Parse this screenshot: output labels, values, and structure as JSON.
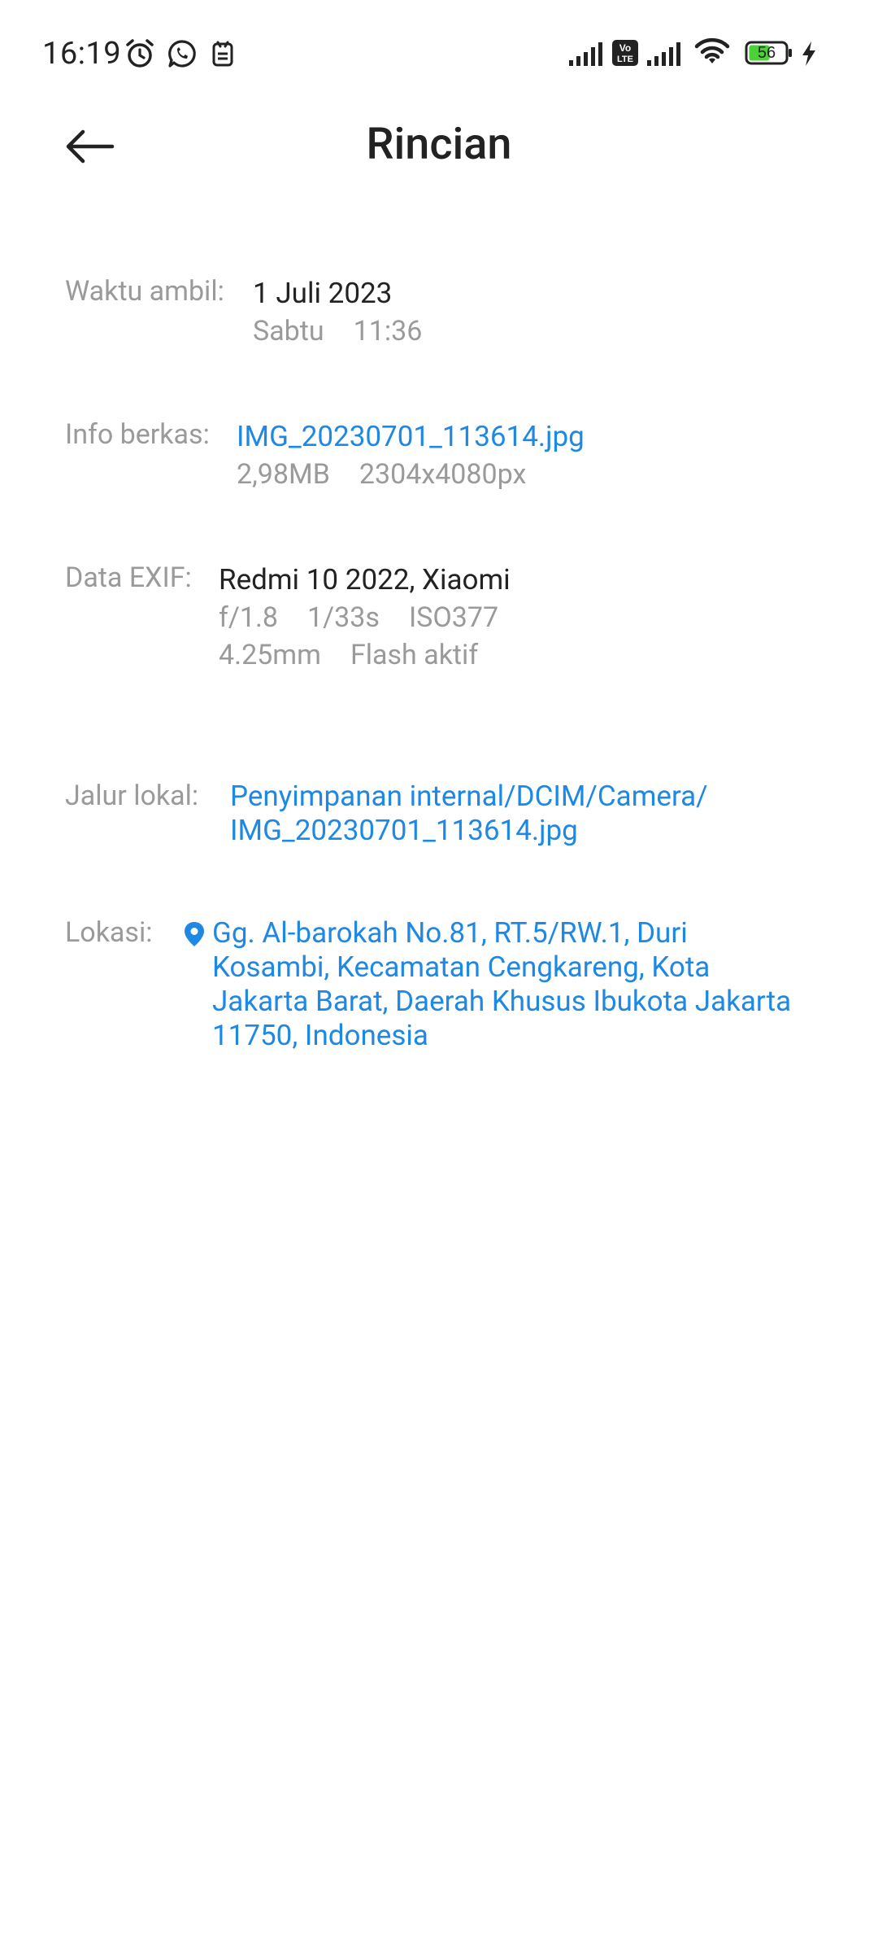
{
  "status_bar": {
    "time": "16:19",
    "battery": "56",
    "volte_badge": "Vo LTE"
  },
  "header": {
    "title": "Rincian"
  },
  "details": {
    "taken": {
      "label": "Waktu ambil:",
      "date": "1 Juli 2023",
      "day": "Sabtu",
      "time": "11:36"
    },
    "file": {
      "label": "Info berkas:",
      "name": "IMG_20230701_113614.jpg",
      "size": "2,98MB",
      "resolution": "2304x4080px"
    },
    "exif": {
      "label": "Data EXIF:",
      "device": "Redmi 10 2022, Xiaomi",
      "aperture": "f/1.8",
      "shutter": "1/33s",
      "iso": "ISO377",
      "focal": "4.25mm",
      "flash": "Flash aktif"
    },
    "path": {
      "label": "Jalur lokal:",
      "line1": "Penyimpanan internal/DCIM/Camera/",
      "line2": "IMG_20230701_113614.jpg"
    },
    "location": {
      "label": "Lokasi:",
      "line1": "Gg. Al-barokah No.81, RT.5/RW.1, Duri",
      "line2": "Kosambi, Kecamatan Cengkareng, Kota",
      "line3": "Jakarta Barat, Daerah Khusus Ibukota Jakarta",
      "line4": "11750, Indonesia"
    }
  },
  "colors": {
    "link": "#1e88e5",
    "label": "#9a9a9a",
    "text": "#222222",
    "battery_fill": "#4cd137"
  },
  "icons": [
    "alarm-icon",
    "whatsapp-icon",
    "sim-toolkit-icon",
    "signal-icon",
    "volte-icon",
    "wifi-icon",
    "battery-icon",
    "charging-icon",
    "back-arrow-icon",
    "location-pin-icon"
  ]
}
